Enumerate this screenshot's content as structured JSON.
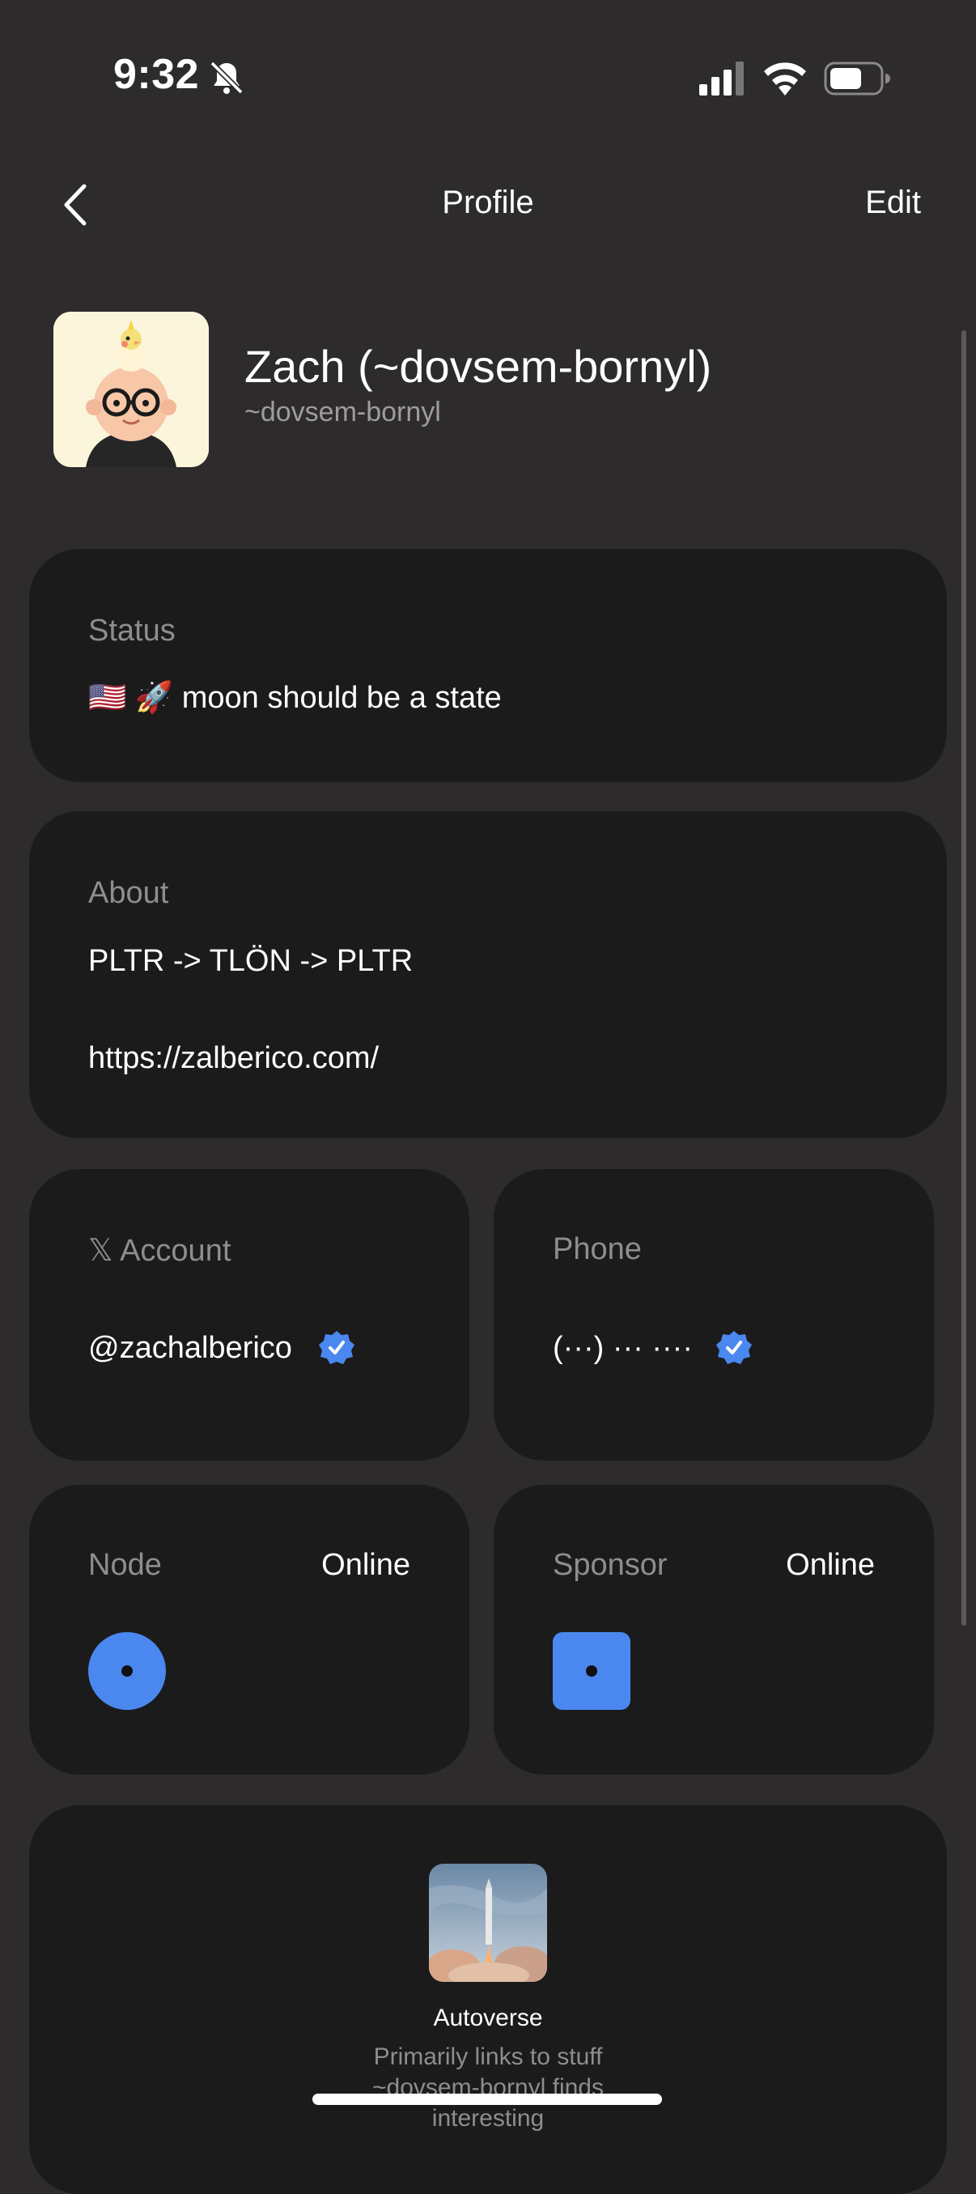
{
  "status_bar": {
    "time": "9:32",
    "icons": [
      "bell-slash-icon",
      "cellular-signal-icon",
      "wifi-icon",
      "battery-icon"
    ]
  },
  "header": {
    "back_icon": "chevron-left-icon",
    "title": "Profile",
    "edit_label": "Edit"
  },
  "profile": {
    "display_name": "Zach (~dovsem-bornyl)",
    "handle": "~dovsem-bornyl"
  },
  "status_card": {
    "label": "Status",
    "text": "🇺🇸 🚀  moon should be a state"
  },
  "about_card": {
    "label": "About",
    "line1": "PLTR -> TLÖN -> PLTR",
    "link": "https://zalberico.com/"
  },
  "x_account_card": {
    "label": "𝕏 Account",
    "value": "@zachalberico",
    "verified_icon": "verified-check-icon"
  },
  "phone_card": {
    "label": "Phone",
    "value": "(···) ··· ····",
    "verified_icon": "verified-check-icon"
  },
  "node_card": {
    "label": "Node",
    "status": "Online"
  },
  "sponsor_card": {
    "label": "Sponsor",
    "status": "Online"
  },
  "featured_group": {
    "title": "Autoverse",
    "description": "Primarily links to stuff ~dovsem-bornyl finds interesting"
  },
  "colors": {
    "background": "#2d2b2b",
    "card": "#1b1b1c",
    "accent_blue": "#4a88ef",
    "muted_text": "#8f8d8d"
  }
}
